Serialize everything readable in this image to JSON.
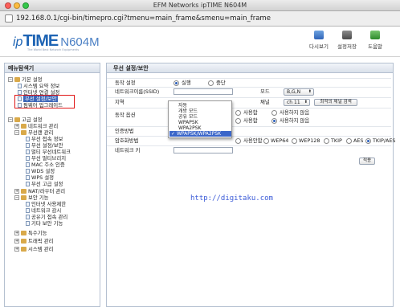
{
  "window": {
    "title": "EFM Networks ipTIME N604M",
    "url": "192.168.0.1/cgi-bin/timepro.cgi?tmenu=main_frame&smenu=main_frame"
  },
  "header": {
    "logo_ip": "ip",
    "logo_time": "TIME",
    "logo_model": "N604M",
    "tagline": "The World Best Network Equipments",
    "buttons": [
      {
        "label": "다시보기",
        "icon": "refresh-icon"
      },
      {
        "label": "설정저장",
        "icon": "save-icon"
      },
      {
        "label": "도움말",
        "icon": "help-icon"
      }
    ]
  },
  "sidebar": {
    "title": "메뉴탐색기",
    "items": [
      {
        "label": "기본 설정",
        "type": "group"
      },
      {
        "label": "시스템 요약 정보",
        "type": "page"
      },
      {
        "label": "인터넷 연결 설정",
        "type": "page"
      },
      {
        "label": "무선 설정/보안",
        "type": "page",
        "selected": true
      },
      {
        "label": "펌웨어 업그레이드",
        "type": "page"
      },
      {
        "label": "고급 설정",
        "type": "group"
      },
      {
        "label": "네트워크 관리",
        "type": "folder"
      },
      {
        "label": "무선랜 관리",
        "type": "folder"
      },
      {
        "label": "무선 접속 정보",
        "type": "page"
      },
      {
        "label": "무선 설정/보안",
        "type": "page"
      },
      {
        "label": "멀티 무선네트워크",
        "type": "page"
      },
      {
        "label": "무선 멀티브리지",
        "type": "page"
      },
      {
        "label": "MAC 주소 인증",
        "type": "page"
      },
      {
        "label": "WDS 설정",
        "type": "page"
      },
      {
        "label": "WPS 설정",
        "type": "page"
      },
      {
        "label": "무선 고급 설정",
        "type": "page"
      },
      {
        "label": "NAT/라우터 관리",
        "type": "folder"
      },
      {
        "label": "보안 기능",
        "type": "folder"
      },
      {
        "label": "인터넷 사용제한",
        "type": "page"
      },
      {
        "label": "네트워크 감시",
        "type": "page"
      },
      {
        "label": "공유기 접속 관리",
        "type": "page"
      },
      {
        "label": "기타 보안 기능",
        "type": "page"
      },
      {
        "label": "특수기능",
        "type": "folder"
      },
      {
        "label": "트래픽 관리",
        "type": "folder"
      },
      {
        "label": "시스템 관리",
        "type": "folder"
      }
    ]
  },
  "main": {
    "title": "무선 설정/보안",
    "operation": {
      "label": "동작 설정",
      "options": [
        "실행",
        "중단"
      ],
      "selected": "실행"
    },
    "ssid": {
      "label": "네트워크이름(SSID)",
      "value": ""
    },
    "mode": {
      "label": "모드",
      "value": "B,G,N"
    },
    "region": {
      "label": "지역"
    },
    "channel": {
      "label": "채널",
      "value": "ch 11",
      "search_button": "최적의 채널 검색"
    },
    "operation_option": {
      "label": "동작 옵션",
      "option1": "사용함",
      "option2": "사용하지 않음",
      "option3": "사용함",
      "option4": "사용하지 않음"
    },
    "auth": {
      "label": "인증방법"
    },
    "encryption": {
      "label": "암호화방법",
      "options": [
        "사용안함",
        "WEP64",
        "WEP128",
        "TKIP",
        "AES",
        "TKIP/AES"
      ],
      "selected": "TKIP/AES"
    },
    "network_key": {
      "label": "네트워크 키",
      "value": ""
    },
    "apply_button": "적용"
  },
  "auth_dropdown": {
    "options": [
      "자동",
      "개방 모드",
      "공유 모드",
      "WPAPSK",
      "WPA2PSK",
      "WPAPSK/WPA2PSK"
    ],
    "selected": "WPAPSK/WPA2PSK",
    "check": "✓"
  },
  "watermark": "http://digitaku.com",
  "colors": {
    "brand": "#1e64b4",
    "selection": "#3b66c9",
    "highlight_box": "#e01818"
  }
}
